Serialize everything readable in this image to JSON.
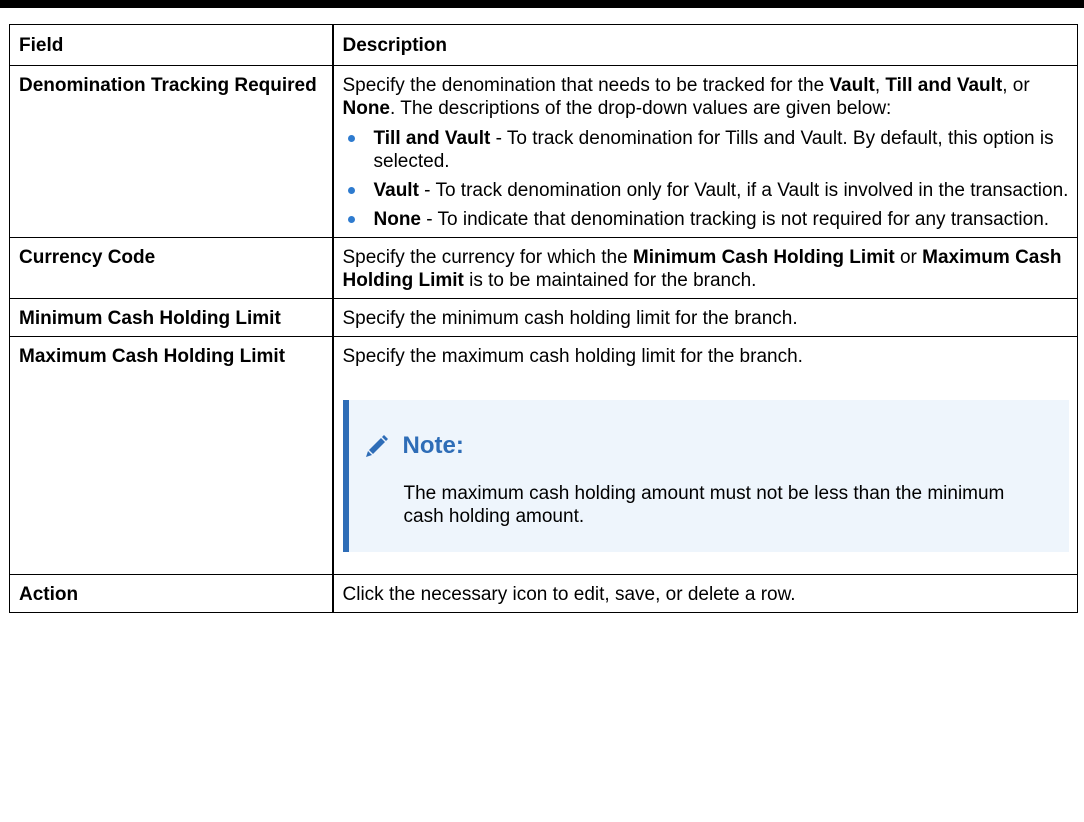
{
  "table": {
    "header": {
      "field": "Field",
      "description": "Description"
    },
    "rows": {
      "denomination": {
        "field": "Denomination Tracking Required",
        "desc_p1": "Specify the denomination that needs to be tracked for the ",
        "desc_b1": "Vault",
        "desc_p2": ", ",
        "desc_b2": "Till and Vault",
        "desc_p3": ", or ",
        "desc_b3": "None",
        "desc_p4": ". The descriptions of the drop-down values are given below:",
        "options": [
          {
            "term": "Till and Vault",
            "text": " - To track denomination for Tills and Vault. By default, this option is selected."
          },
          {
            "term": "Vault",
            "text": " - To track denomination only for Vault, if a Vault is involved in the transaction."
          },
          {
            "term": "None",
            "text": " - To indicate that denomination tracking is not required for any transaction."
          }
        ]
      },
      "currency": {
        "field": "Currency Code",
        "desc_p1": "Specify the currency for which the ",
        "desc_b1": "Minimum Cash Holding Limit",
        "desc_p2": " or ",
        "desc_b2": "Maximum Cash Holding Limit",
        "desc_p3": " is to be maintained for the branch."
      },
      "min_limit": {
        "field": "Minimum Cash Holding Limit",
        "desc": "Specify the minimum cash holding limit for the branch."
      },
      "max_limit": {
        "field": "Maximum Cash Holding Limit",
        "desc": "Specify the maximum cash holding limit for the branch.",
        "note": {
          "icon": "pencil-icon",
          "title": "Note:",
          "text": "The maximum cash holding amount must not be less than the minimum cash holding amount."
        }
      },
      "action": {
        "field": "Action",
        "desc": "Click the necessary icon to edit, save, or delete a row."
      }
    }
  },
  "colors": {
    "bullet": "#2e7bcf",
    "note_accent": "#2e6db7",
    "note_background": "#eef5fc"
  }
}
